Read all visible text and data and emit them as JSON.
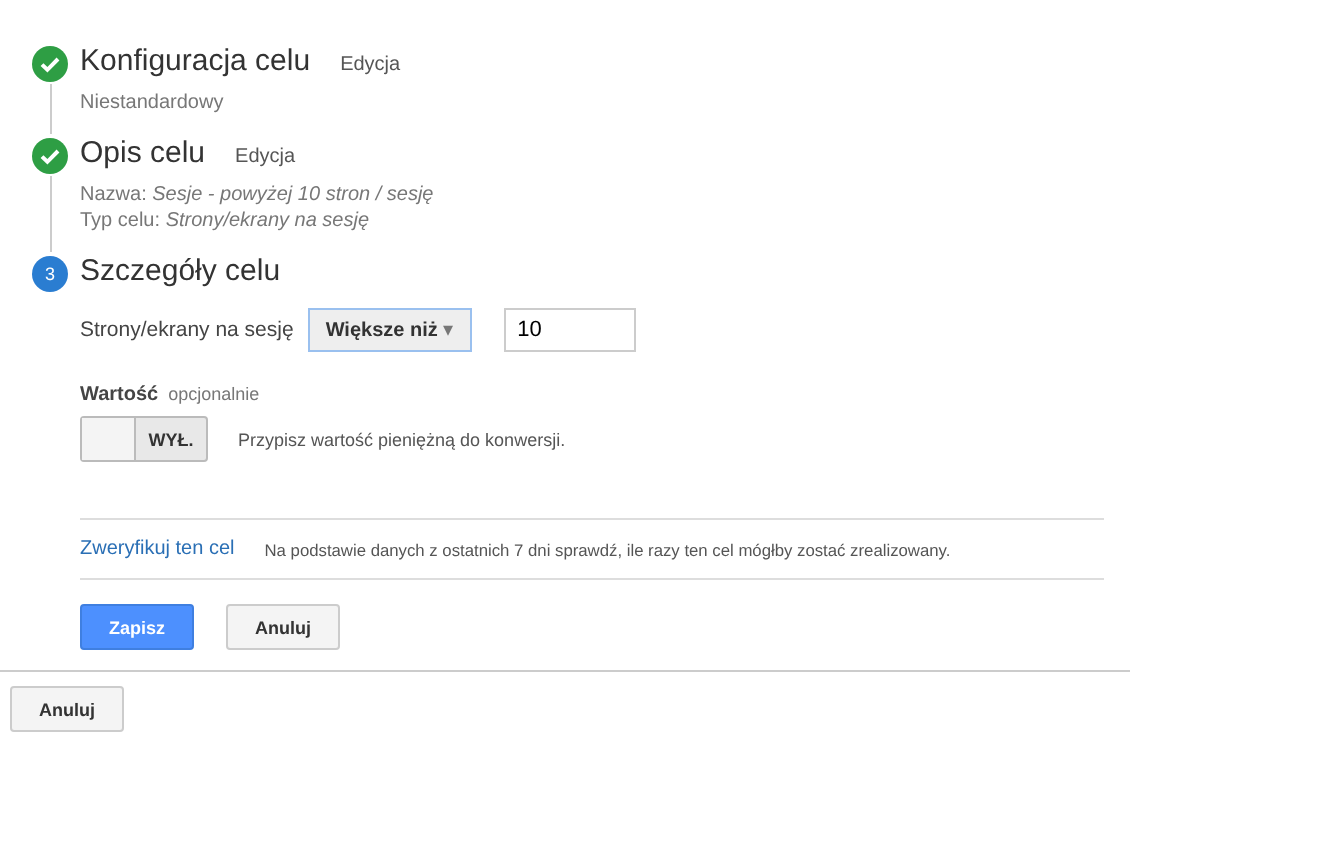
{
  "steps": [
    {
      "kind": "done",
      "title": "Konfiguracja celu",
      "edit": "Edycja",
      "details": [
        "Niestandardowy"
      ]
    },
    {
      "kind": "done",
      "title": "Opis celu",
      "edit": "Edycja",
      "details": [
        "Nazwa: *Sesje - powyżej 10 stron / sesję*",
        "Typ celu: *Strony/ekrany na sesję*"
      ]
    },
    {
      "kind": "current",
      "marker": "3",
      "title": "Szczegóły celu"
    }
  ],
  "condition": {
    "label": "Strony/ekrany na sesję",
    "operator": "Większe niż",
    "caret": "▾",
    "value": "10"
  },
  "value_setting": {
    "label": "Wartość",
    "hint": "opcjonalnie",
    "toggle_label": "WYŁ.",
    "on": false,
    "description": "Przypisz wartość pieniężną do konwersji."
  },
  "verify": {
    "link": "Zweryfikuj ten cel",
    "description": "Na podstawie danych z ostatnich 7 dni sprawdź, ile razy ten cel mógłby zostać zrealizowany."
  },
  "buttons": {
    "save": "Zapisz",
    "cancel": "Anuluj"
  },
  "outer_cancel": "Anuluj"
}
